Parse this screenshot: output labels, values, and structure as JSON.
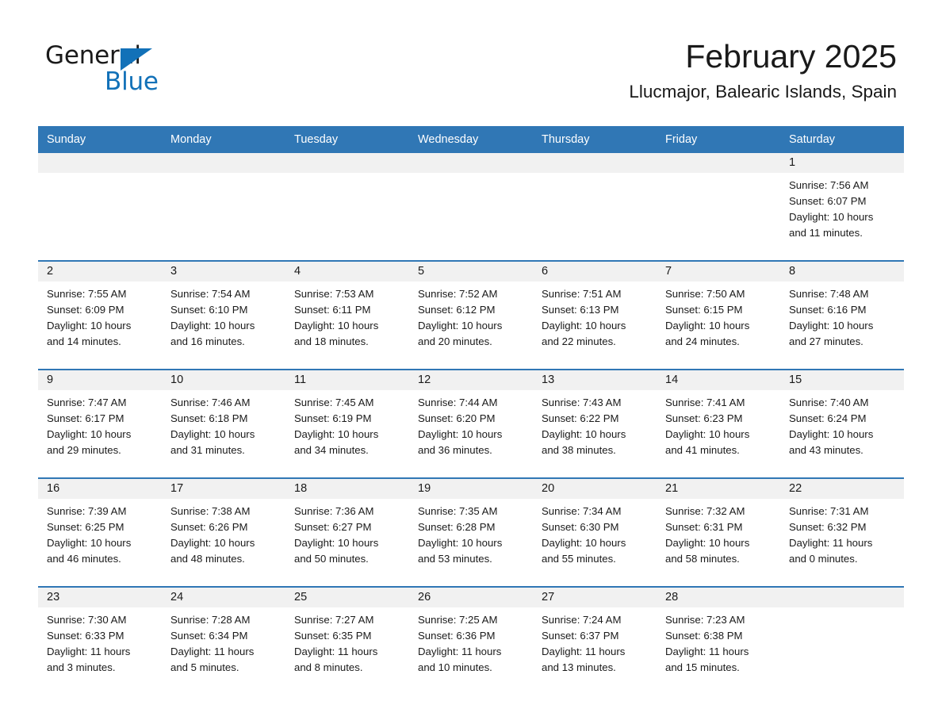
{
  "brand": {
    "name_primary": "General",
    "name_secondary": "Blue",
    "triangle_icon": "triangle-icon",
    "accent_color": "#1271b8"
  },
  "header": {
    "title": "February 2025",
    "subtitle": "Llucmajor, Balearic Islands, Spain"
  },
  "theme": {
    "header_blue": "#3077b5",
    "date_band_gray": "#f1f1f1",
    "text_color": "#1a1a1a"
  },
  "calendar": {
    "day_headers": [
      "Sunday",
      "Monday",
      "Tuesday",
      "Wednesday",
      "Thursday",
      "Friday",
      "Saturday"
    ],
    "weeks": [
      [
        {
          "date": "",
          "sunrise": "",
          "sunset": "",
          "daylight_line1": "",
          "daylight_line2": "",
          "empty": true
        },
        {
          "date": "",
          "sunrise": "",
          "sunset": "",
          "daylight_line1": "",
          "daylight_line2": "",
          "empty": true
        },
        {
          "date": "",
          "sunrise": "",
          "sunset": "",
          "daylight_line1": "",
          "daylight_line2": "",
          "empty": true
        },
        {
          "date": "",
          "sunrise": "",
          "sunset": "",
          "daylight_line1": "",
          "daylight_line2": "",
          "empty": true
        },
        {
          "date": "",
          "sunrise": "",
          "sunset": "",
          "daylight_line1": "",
          "daylight_line2": "",
          "empty": true
        },
        {
          "date": "",
          "sunrise": "",
          "sunset": "",
          "daylight_line1": "",
          "daylight_line2": "",
          "empty": true
        },
        {
          "date": "1",
          "sunrise": "Sunrise: 7:56 AM",
          "sunset": "Sunset: 6:07 PM",
          "daylight_line1": "Daylight: 10 hours",
          "daylight_line2": "and 11 minutes."
        }
      ],
      [
        {
          "date": "2",
          "sunrise": "Sunrise: 7:55 AM",
          "sunset": "Sunset: 6:09 PM",
          "daylight_line1": "Daylight: 10 hours",
          "daylight_line2": "and 14 minutes."
        },
        {
          "date": "3",
          "sunrise": "Sunrise: 7:54 AM",
          "sunset": "Sunset: 6:10 PM",
          "daylight_line1": "Daylight: 10 hours",
          "daylight_line2": "and 16 minutes."
        },
        {
          "date": "4",
          "sunrise": "Sunrise: 7:53 AM",
          "sunset": "Sunset: 6:11 PM",
          "daylight_line1": "Daylight: 10 hours",
          "daylight_line2": "and 18 minutes."
        },
        {
          "date": "5",
          "sunrise": "Sunrise: 7:52 AM",
          "sunset": "Sunset: 6:12 PM",
          "daylight_line1": "Daylight: 10 hours",
          "daylight_line2": "and 20 minutes."
        },
        {
          "date": "6",
          "sunrise": "Sunrise: 7:51 AM",
          "sunset": "Sunset: 6:13 PM",
          "daylight_line1": "Daylight: 10 hours",
          "daylight_line2": "and 22 minutes."
        },
        {
          "date": "7",
          "sunrise": "Sunrise: 7:50 AM",
          "sunset": "Sunset: 6:15 PM",
          "daylight_line1": "Daylight: 10 hours",
          "daylight_line2": "and 24 minutes."
        },
        {
          "date": "8",
          "sunrise": "Sunrise: 7:48 AM",
          "sunset": "Sunset: 6:16 PM",
          "daylight_line1": "Daylight: 10 hours",
          "daylight_line2": "and 27 minutes."
        }
      ],
      [
        {
          "date": "9",
          "sunrise": "Sunrise: 7:47 AM",
          "sunset": "Sunset: 6:17 PM",
          "daylight_line1": "Daylight: 10 hours",
          "daylight_line2": "and 29 minutes."
        },
        {
          "date": "10",
          "sunrise": "Sunrise: 7:46 AM",
          "sunset": "Sunset: 6:18 PM",
          "daylight_line1": "Daylight: 10 hours",
          "daylight_line2": "and 31 minutes."
        },
        {
          "date": "11",
          "sunrise": "Sunrise: 7:45 AM",
          "sunset": "Sunset: 6:19 PM",
          "daylight_line1": "Daylight: 10 hours",
          "daylight_line2": "and 34 minutes."
        },
        {
          "date": "12",
          "sunrise": "Sunrise: 7:44 AM",
          "sunset": "Sunset: 6:20 PM",
          "daylight_line1": "Daylight: 10 hours",
          "daylight_line2": "and 36 minutes."
        },
        {
          "date": "13",
          "sunrise": "Sunrise: 7:43 AM",
          "sunset": "Sunset: 6:22 PM",
          "daylight_line1": "Daylight: 10 hours",
          "daylight_line2": "and 38 minutes."
        },
        {
          "date": "14",
          "sunrise": "Sunrise: 7:41 AM",
          "sunset": "Sunset: 6:23 PM",
          "daylight_line1": "Daylight: 10 hours",
          "daylight_line2": "and 41 minutes."
        },
        {
          "date": "15",
          "sunrise": "Sunrise: 7:40 AM",
          "sunset": "Sunset: 6:24 PM",
          "daylight_line1": "Daylight: 10 hours",
          "daylight_line2": "and 43 minutes."
        }
      ],
      [
        {
          "date": "16",
          "sunrise": "Sunrise: 7:39 AM",
          "sunset": "Sunset: 6:25 PM",
          "daylight_line1": "Daylight: 10 hours",
          "daylight_line2": "and 46 minutes."
        },
        {
          "date": "17",
          "sunrise": "Sunrise: 7:38 AM",
          "sunset": "Sunset: 6:26 PM",
          "daylight_line1": "Daylight: 10 hours",
          "daylight_line2": "and 48 minutes."
        },
        {
          "date": "18",
          "sunrise": "Sunrise: 7:36 AM",
          "sunset": "Sunset: 6:27 PM",
          "daylight_line1": "Daylight: 10 hours",
          "daylight_line2": "and 50 minutes."
        },
        {
          "date": "19",
          "sunrise": "Sunrise: 7:35 AM",
          "sunset": "Sunset: 6:28 PM",
          "daylight_line1": "Daylight: 10 hours",
          "daylight_line2": "and 53 minutes."
        },
        {
          "date": "20",
          "sunrise": "Sunrise: 7:34 AM",
          "sunset": "Sunset: 6:30 PM",
          "daylight_line1": "Daylight: 10 hours",
          "daylight_line2": "and 55 minutes."
        },
        {
          "date": "21",
          "sunrise": "Sunrise: 7:32 AM",
          "sunset": "Sunset: 6:31 PM",
          "daylight_line1": "Daylight: 10 hours",
          "daylight_line2": "and 58 minutes."
        },
        {
          "date": "22",
          "sunrise": "Sunrise: 7:31 AM",
          "sunset": "Sunset: 6:32 PM",
          "daylight_line1": "Daylight: 11 hours",
          "daylight_line2": "and 0 minutes."
        }
      ],
      [
        {
          "date": "23",
          "sunrise": "Sunrise: 7:30 AM",
          "sunset": "Sunset: 6:33 PM",
          "daylight_line1": "Daylight: 11 hours",
          "daylight_line2": "and 3 minutes."
        },
        {
          "date": "24",
          "sunrise": "Sunrise: 7:28 AM",
          "sunset": "Sunset: 6:34 PM",
          "daylight_line1": "Daylight: 11 hours",
          "daylight_line2": "and 5 minutes."
        },
        {
          "date": "25",
          "sunrise": "Sunrise: 7:27 AM",
          "sunset": "Sunset: 6:35 PM",
          "daylight_line1": "Daylight: 11 hours",
          "daylight_line2": "and 8 minutes."
        },
        {
          "date": "26",
          "sunrise": "Sunrise: 7:25 AM",
          "sunset": "Sunset: 6:36 PM",
          "daylight_line1": "Daylight: 11 hours",
          "daylight_line2": "and 10 minutes."
        },
        {
          "date": "27",
          "sunrise": "Sunrise: 7:24 AM",
          "sunset": "Sunset: 6:37 PM",
          "daylight_line1": "Daylight: 11 hours",
          "daylight_line2": "and 13 minutes."
        },
        {
          "date": "28",
          "sunrise": "Sunrise: 7:23 AM",
          "sunset": "Sunset: 6:38 PM",
          "daylight_line1": "Daylight: 11 hours",
          "daylight_line2": "and 15 minutes."
        },
        {
          "date": "",
          "sunrise": "",
          "sunset": "",
          "daylight_line1": "",
          "daylight_line2": "",
          "empty": true
        }
      ]
    ]
  }
}
